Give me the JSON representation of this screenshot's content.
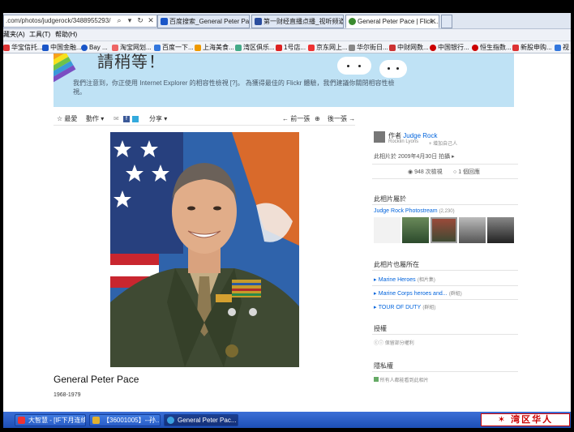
{
  "browser": {
    "address": ".com/photos/judgerock/3488955293/",
    "tabs": [
      {
        "label": "百度搜索_General Peter Pace",
        "color": "#1a56c8"
      },
      {
        "label": "第一财经直播点播_视听频道_...",
        "color": "#2a4d9e"
      },
      {
        "label": "General Peter Pace | Flick...",
        "color": "#3a8a2e"
      }
    ],
    "menu": [
      "藏夹(A)",
      "工具(T)",
      "帮助(H)"
    ],
    "favorites": [
      {
        "label": "华宝信托...",
        "color": "#d33"
      },
      {
        "label": "中国金融...",
        "color": "#1a56c8"
      },
      {
        "label": "Bay ...",
        "color": "#1a56c8"
      },
      {
        "label": "淘宝网划...",
        "color": "#e66"
      },
      {
        "label": "百度一下...",
        "color": "#37d"
      },
      {
        "label": "上海美食...",
        "color": "#e90"
      },
      {
        "label": "湾区俱乐...",
        "color": "#4a8"
      },
      {
        "label": "1号店...",
        "color": "#d22"
      },
      {
        "label": "京东网上...",
        "color": "#e33"
      },
      {
        "label": "华尔街日...",
        "color": "#888"
      },
      {
        "label": "中财网数...",
        "color": "#c33"
      },
      {
        "label": "中国银行...",
        "color": "#c00"
      },
      {
        "label": "恒生指数...",
        "color": "#c00"
      },
      {
        "label": "新股申购...",
        "color": "#d33"
      },
      {
        "label": "视",
        "color": "#37d"
      }
    ]
  },
  "banner": {
    "title": "請稍等！",
    "message": "我們注意到，你正使用 Internet Explorer 的相容性檢視 [?]。 為獲得最佳的 Flickr 體驗，我們建議你關閉相容性檢視。"
  },
  "toolbar": {
    "fave": "最愛",
    "actions": "動作",
    "share": "分享",
    "prev": "前一張",
    "next": "後一張"
  },
  "photo": {
    "title": "General Peter Pace",
    "description": "1968-1979"
  },
  "sidebar": {
    "author_label": "作者",
    "author_name": "Judge Rock",
    "author_real": "Rocklin Lyons",
    "add_contact": "+ 增加自己人",
    "date": "此相片於 2009年4月30日 拍攝 ▸",
    "views": "948 次檢視",
    "comments": "1 個回應",
    "belongs_title": "此相片屬於",
    "photostream": "Judge Rock Photostream",
    "photostream_count": "(2,230)",
    "also_title": "此相片也屬所在",
    "sets": [
      {
        "name": "Marine Heroes",
        "type": "(相片集)"
      },
      {
        "name": "Marine Corps heroes and...",
        "type": "(群組)"
      },
      {
        "name": "TOUR OF DUTY",
        "type": "(群組)"
      }
    ],
    "license_title": "授權",
    "license_text": "保留部分權利",
    "privacy_title": "隱私權",
    "privacy_text": "所有人都能看到此相片"
  },
  "taskbar": {
    "tasks": [
      {
        "label": "大智慧 - [IF下月连续]",
        "color": "#e33"
      },
      {
        "label": "【36001005】--孙...",
        "color": "#e0b030"
      },
      {
        "label": "General Peter Pac...",
        "color": "#3aa0e0"
      }
    ],
    "tray_logo": "✶ 湾区华人"
  }
}
